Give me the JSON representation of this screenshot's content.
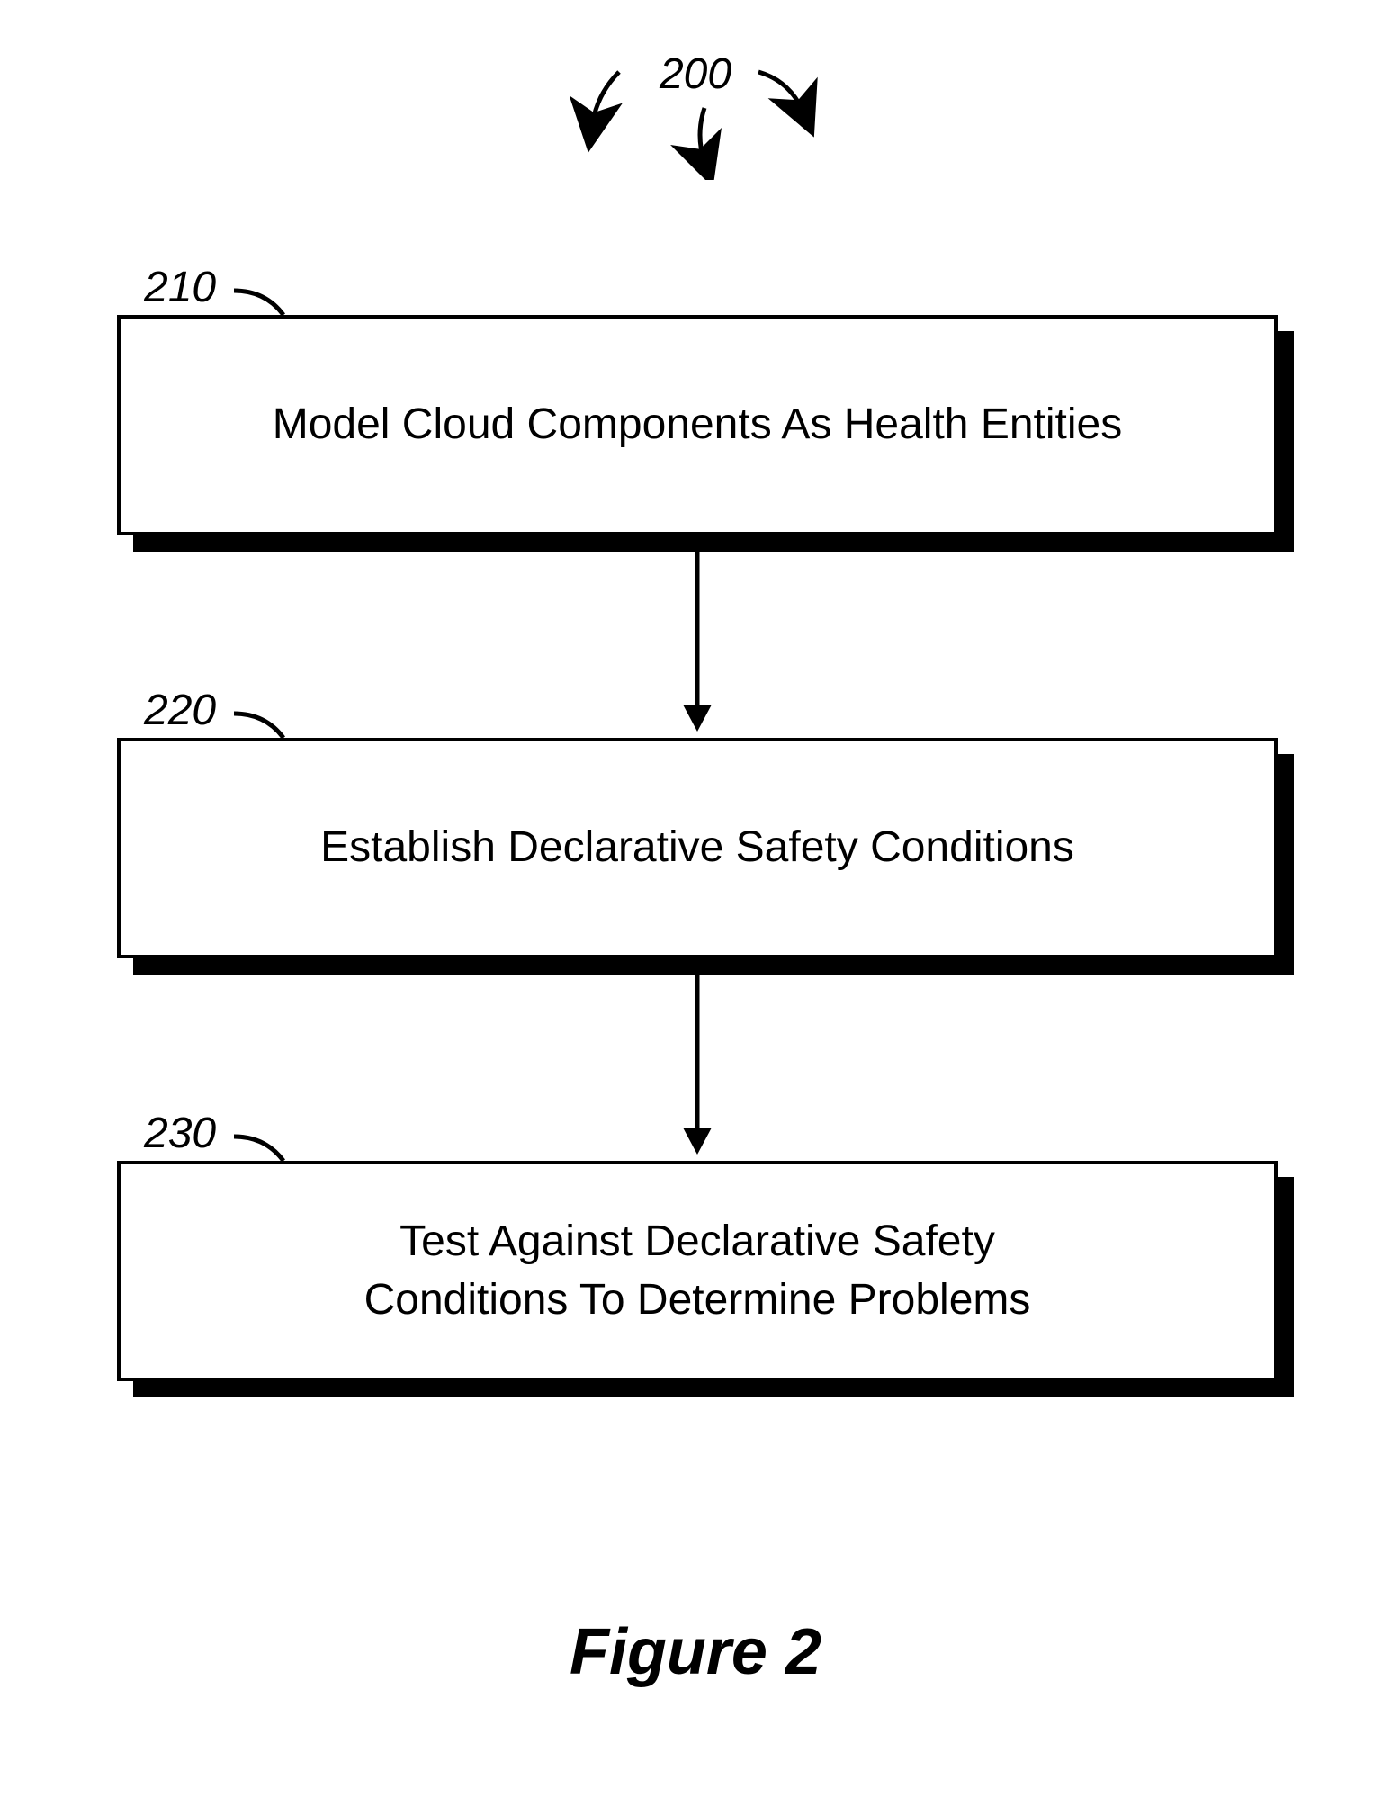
{
  "chart_data": {
    "type": "flowchart",
    "title_ref": "200",
    "nodes": [
      {
        "id": "210",
        "text": "Model Cloud Components As Health Entities",
        "order": 1
      },
      {
        "id": "220",
        "text": "Establish Declarative Safety Conditions",
        "order": 2
      },
      {
        "id": "230",
        "text": "Test Against Declarative Safety\nConditions To Determine Problems",
        "order": 3
      }
    ],
    "edges": [
      {
        "from": "210",
        "to": "220"
      },
      {
        "from": "220",
        "to": "230"
      }
    ],
    "caption": "Figure 2"
  },
  "title_number": "200",
  "steps": {
    "s1": {
      "label": "210",
      "text": "Model Cloud Components As Health Entities"
    },
    "s2": {
      "label": "220",
      "text": "Establish Declarative Safety Conditions"
    },
    "s3": {
      "label": "230",
      "text": "Test Against Declarative Safety\nConditions To Determine Problems"
    }
  },
  "caption": "Figure 2"
}
